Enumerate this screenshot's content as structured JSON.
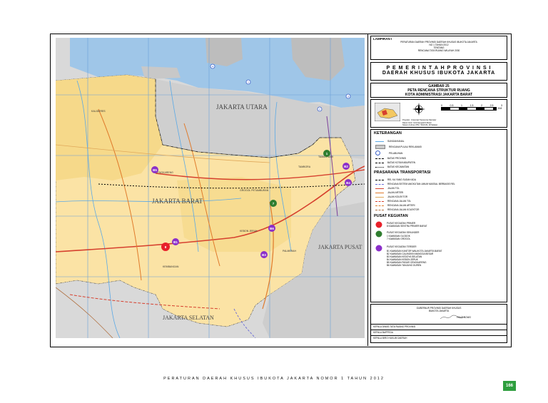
{
  "lampiran": {
    "title": "LAMPIRAN I",
    "line1": "PERATURAN DAERAH PROVINSI DAERAH KHUSUS IBUKOTA JAKARTA",
    "line2": "NO 1 TAHUN 2012",
    "line3": "TENTANG",
    "line4": "RENCANA TATA RUANG WILAYAH 2030"
  },
  "header": {
    "line1": "P E M E R I N T A H   P R O V I N S I",
    "line2": "DAERAH KHUSUS IBUKOTA JAKARTA"
  },
  "map_title": {
    "line1": "GAMBAR 25",
    "line2": "PETA RENCANA STRUKTUR RUANG",
    "line3": "KOTA ADMINISTRASI JAKARTA BARAT"
  },
  "scale": {
    "ticks": [
      "0",
      "0.5",
      "1",
      "1.5",
      "2",
      "2.5",
      "3"
    ],
    "unit": "KM"
  },
  "legend": {
    "title": "KETERANGAN",
    "items": [
      {
        "label": "SUNGAI/KANAL",
        "color": "#5aa9e6",
        "style": "solid"
      },
      {
        "label": "RENCANA PULAU REKLAMASI",
        "color": "#cccccc",
        "style": "box"
      },
      {
        "label": "PELABUHAN",
        "color": "#3a5fc8",
        "style": "circle"
      },
      {
        "label": "BATAS PROVINSI",
        "color": "#000000",
        "style": "dash"
      },
      {
        "label": "BATAS KOTA/KABUPATEN",
        "color": "#000000",
        "style": "dashdot"
      },
      {
        "label": "BATAS KECAMATAN",
        "color": "#000000",
        "style": "dot"
      }
    ],
    "transport_title": "PRASARANA TRANSPORTASI",
    "transport": [
      {
        "label": "REL KA YANG SUDAH ADA",
        "color": "#000000",
        "style": "rail"
      },
      {
        "label": "RENCANA SISTEM ANGKUTAN UMUM MASSAL BERBASIS REL",
        "color": "#6b6bd6",
        "style": "dash"
      },
      {
        "label": "JALAN TOL",
        "color": "#d6402e",
        "style": "solid"
      },
      {
        "label": "JALAN ARTERI",
        "color": "#e07b2c",
        "style": "solid"
      },
      {
        "label": "JALAN KOLEKTOR",
        "color": "#e0a85a",
        "style": "solid"
      },
      {
        "label": "RENCANA JALAN TOL",
        "color": "#d6402e",
        "style": "dash"
      },
      {
        "label": "RENCANA JALAN ARTERI",
        "color": "#e07b2c",
        "style": "dash"
      },
      {
        "label": "RENCANA JALAN KOLEKTOR",
        "color": "#b07040",
        "style": "dash"
      }
    ],
    "pusat_title": "PUSAT KEGIATAN",
    "primer_title": "PUSAT KEGIATAN PRIMER",
    "primer_items": [
      "8  KAWASAN SENTRA PRIMER BARAT"
    ],
    "sekunder_title": "PUSAT KEGIATAN SEKUNDER",
    "sekunder_items": [
      "1   KAWASAN GLODOK",
      "7   KAWASAN GROGOL"
    ],
    "tersier_title": "PUSAT KEGIATAN TERSIER",
    "tersier_items": [
      "B1  KAWASAN KANTOR WALIKOTA JAKARTA BARAT",
      "B2  KAWASAN CALINGKIN MANGGA BESAR",
      "B3  KAWASAN KEDOYA SELATAN",
      "B4  KAWASAN KEBON JERUK",
      "B5  KAWASAN PASAR CENGKARENG",
      "B6  KAWASAN TANJUNG DUREN"
    ],
    "colors": {
      "primer": "#e8202a",
      "sekunder": "#2f7d2f",
      "tersier": "#8b2fc9"
    }
  },
  "signature": {
    "line1": "GUBERNUR PROVINSI DAERAH KHUSUS",
    "line2": "IBUKOTA JAKARTA",
    "name": "FAUZI BOWO",
    "rows": [
      "KEPALA DINAS TATA RUANG PROVINSI",
      "KEPALA BAPPEDA",
      "KEPALA BIRO HUKUM DAERAH"
    ]
  },
  "inset": {
    "notes": [
      "Proyeksi  : Universal Transverse Mercator",
      "Datum Grid  : Grid Geografi & Meter",
      "Sistem & Zona UTM  : WGS 84, 48 Selatan"
    ]
  },
  "map": {
    "labels": [
      {
        "id": "jakarta-utara",
        "text": "JAKARTA UTARA"
      },
      {
        "id": "jakarta-barat",
        "text": "JAKARTA BARAT"
      },
      {
        "id": "jakarta-selatan",
        "text": "JAKARTA SELATAN"
      },
      {
        "id": "jakarta-pusat",
        "text": "JAKARTA PUSAT"
      },
      {
        "id": "kalideres",
        "text": "KALIDERES"
      },
      {
        "id": "cengkareng",
        "text": "CENGKARENG"
      },
      {
        "id": "grogol",
        "text": "GROGOL PETAMBURAN"
      },
      {
        "id": "kebon-jeruk",
        "text": "KEBON JERUK"
      },
      {
        "id": "kembangan",
        "text": "KEMBANGAN"
      },
      {
        "id": "palmerah",
        "text": "PALMERAH"
      },
      {
        "id": "tambora",
        "text": "TAMBORA"
      },
      {
        "id": "taman-sari",
        "text": "TAMAN SARI"
      }
    ],
    "markers": [
      {
        "id": "m8",
        "text": "8",
        "kind": "primer"
      },
      {
        "id": "m1",
        "text": "1",
        "kind": "sekunder"
      },
      {
        "id": "m7",
        "text": "7",
        "kind": "sekunder"
      },
      {
        "id": "mb1",
        "text": "B1",
        "kind": "tersier"
      },
      {
        "id": "mb2",
        "text": "B2",
        "kind": "tersier"
      },
      {
        "id": "mb3",
        "text": "B3",
        "kind": "tersier"
      },
      {
        "id": "mb4",
        "text": "B4",
        "kind": "tersier"
      },
      {
        "id": "mb5",
        "text": "B5",
        "kind": "tersier"
      },
      {
        "id": "mb6",
        "text": "B6",
        "kind": "tersier"
      }
    ],
    "port_marks": [
      "1",
      "2",
      "3",
      "4"
    ]
  },
  "footer": {
    "text": "PERATURAN DAERAH KHUSUS IBUKOTA JAKARTA NOMOR 1 TAHUN 2012",
    "page": "166"
  }
}
